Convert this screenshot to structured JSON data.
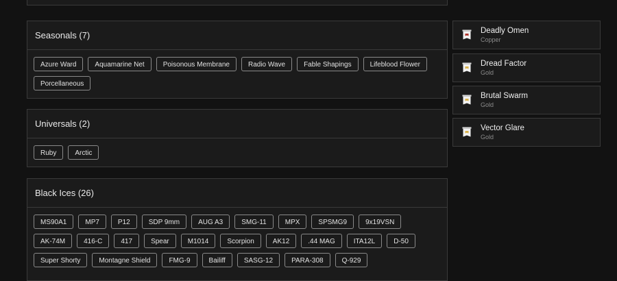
{
  "seasonals": {
    "title": "Seasonals (7)",
    "items": [
      "Azure Ward",
      "Aquamarine Net",
      "Poisonous Membrane",
      "Radio Wave",
      "Fable Shapings",
      "Lifeblood Flower",
      "Porcellaneous"
    ]
  },
  "universals": {
    "title": "Universals (2)",
    "items": [
      "Ruby",
      "Arctic"
    ]
  },
  "black_ices": {
    "title": "Black Ices (26)",
    "items": [
      "MS90A1",
      "MP7",
      "P12",
      "SDP 9mm",
      "AUG A3",
      "SMG-11",
      "MPX",
      "SPSMG9",
      "9x19VSN",
      "AK-74M",
      "416-C",
      "417",
      "Spear",
      "M1014",
      "Scorpion",
      "AK12",
      ".44 MAG",
      "ITA12L",
      "D-50",
      "Super Shorty",
      "Montagne Shield",
      "FMG-9",
      "Bailiff",
      "SASG-12",
      "PARA-308",
      "Q-929"
    ]
  },
  "charms": [
    {
      "name": "Deadly Omen",
      "tier": "Copper",
      "icon": "banner-icon",
      "accent": "#b0342d"
    },
    {
      "name": "Dread Factor",
      "tier": "Gold",
      "icon": "banner-icon",
      "accent": "#d9b24a"
    },
    {
      "name": "Brutal Swarm",
      "tier": "Gold",
      "icon": "banner-icon",
      "accent": "#d9b24a"
    },
    {
      "name": "Vector Glare",
      "tier": "Gold",
      "icon": "banner-icon",
      "accent": "#d9b24a"
    }
  ],
  "colors": {
    "background": "#121212",
    "panel": "#1b1b1b",
    "border": "#3a3a3a",
    "chip_border": "#8a8a8a"
  }
}
